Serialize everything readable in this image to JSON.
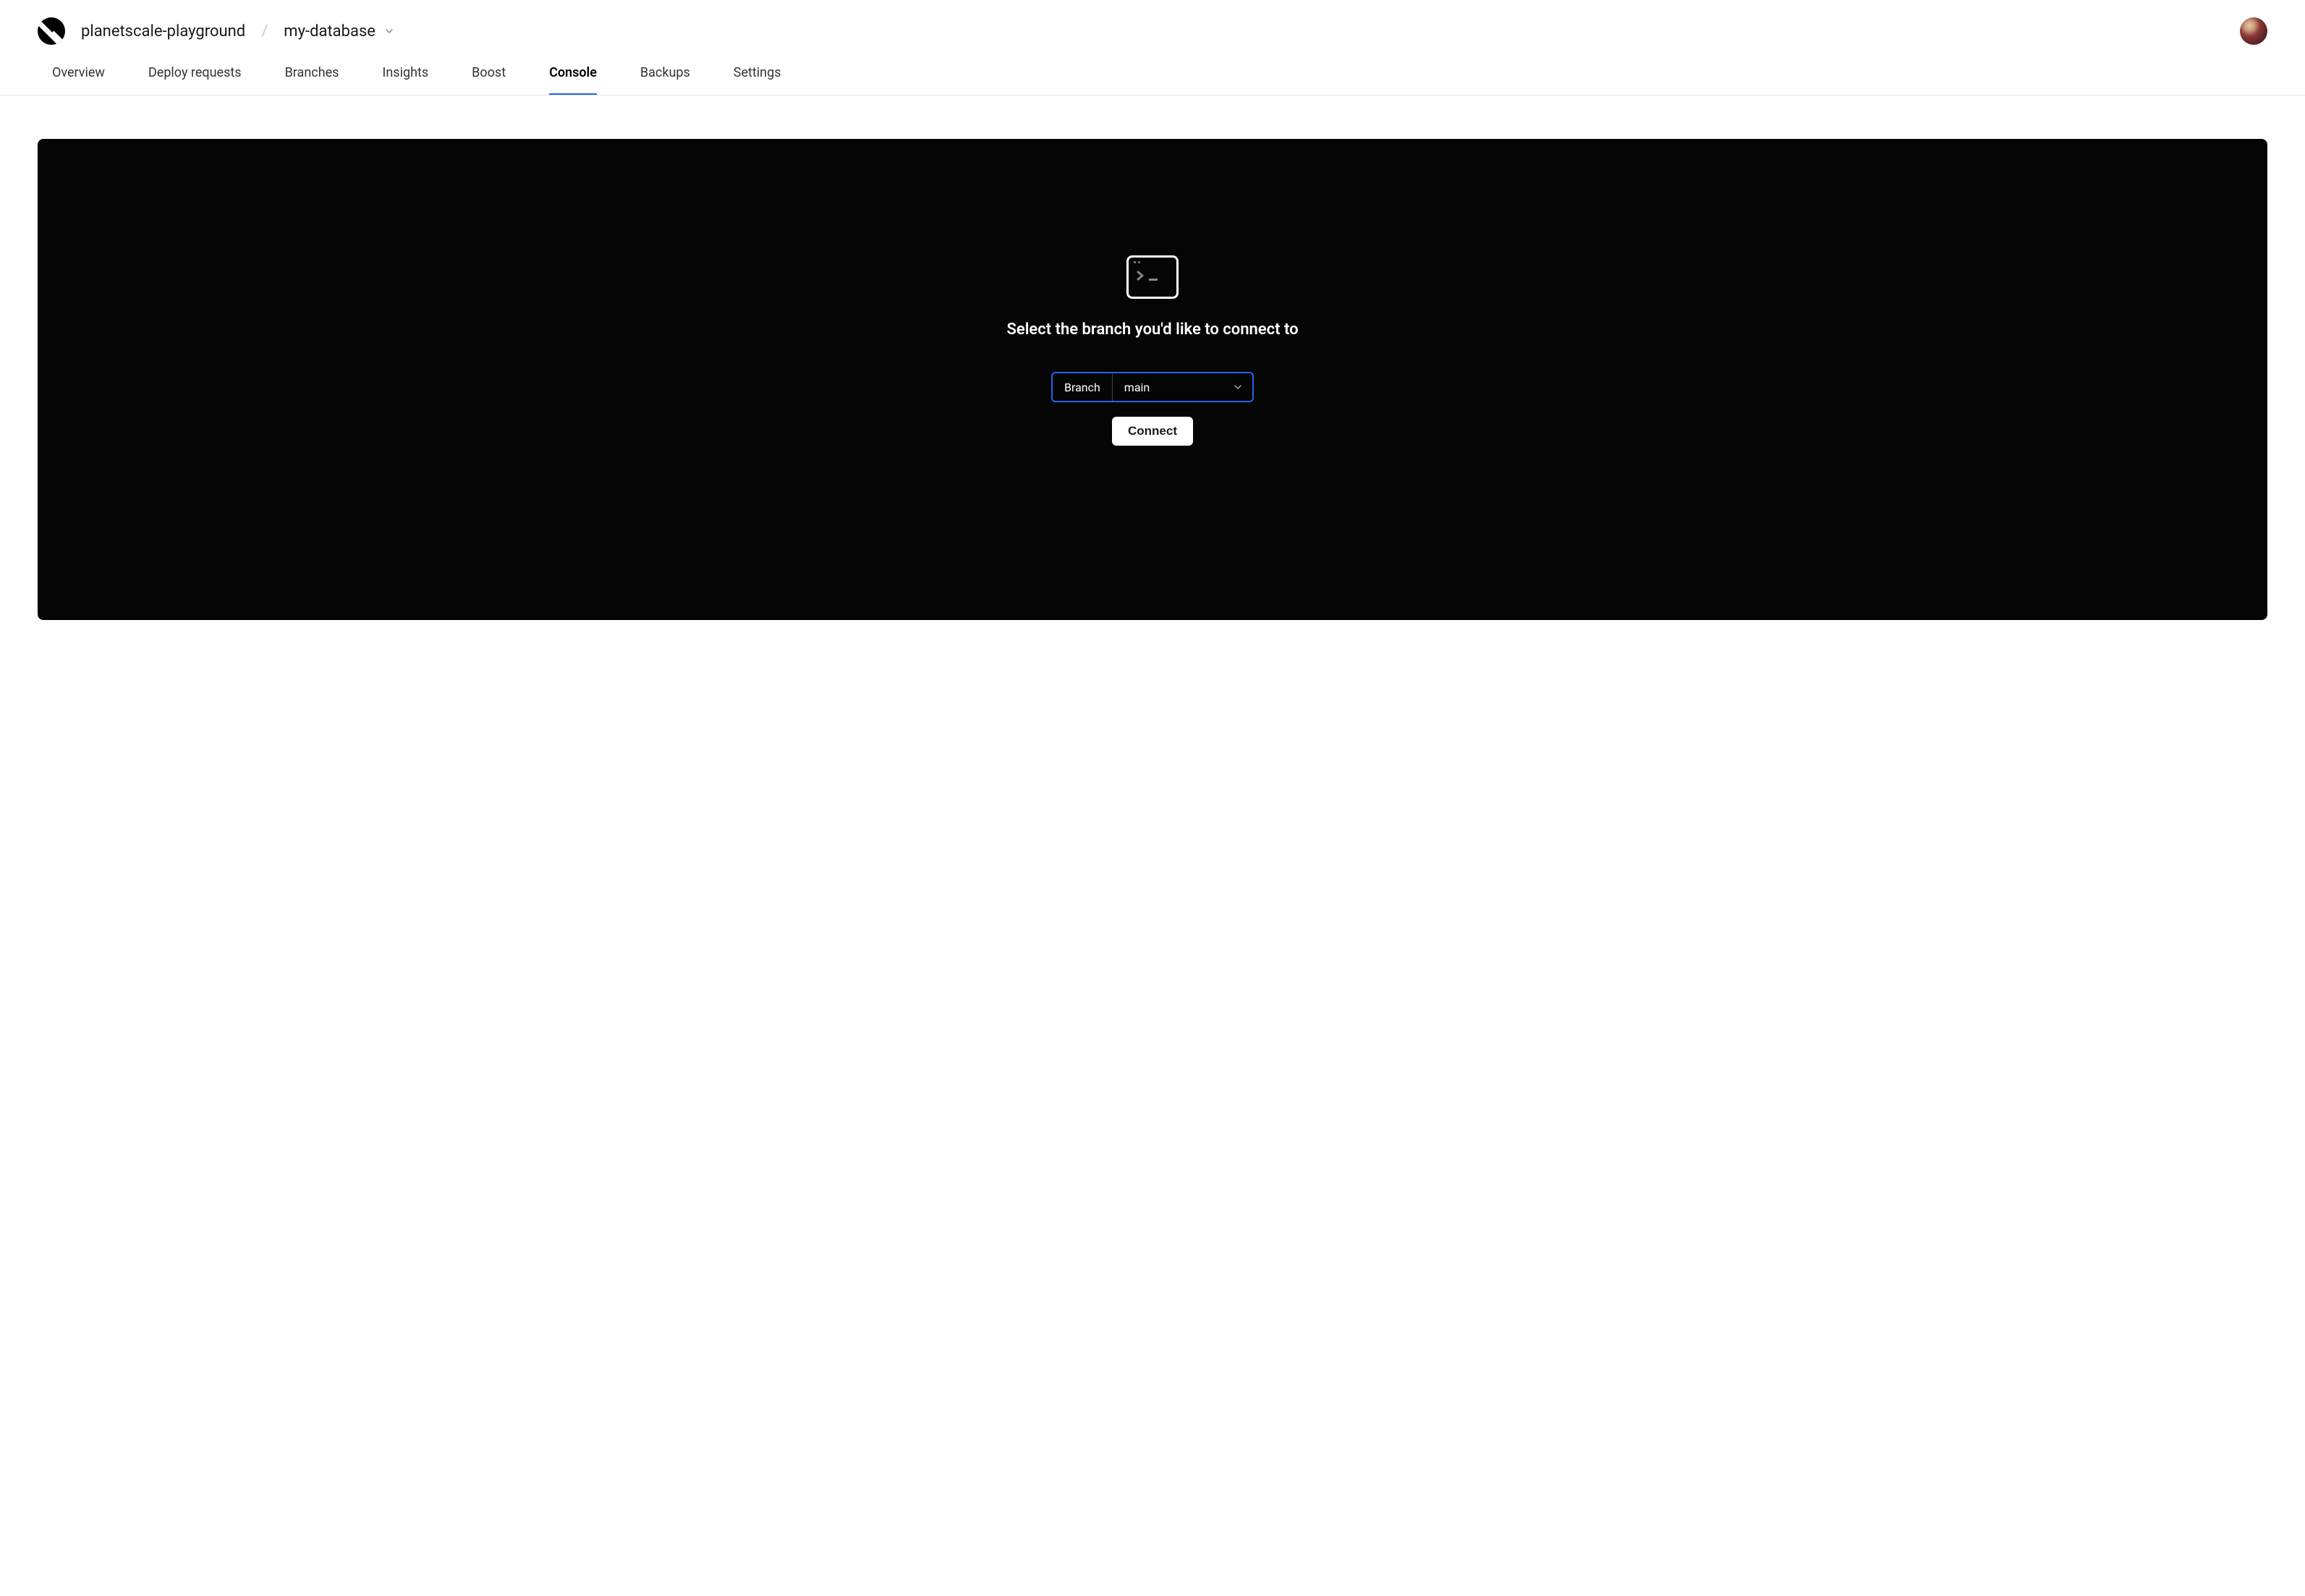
{
  "breadcrumb": {
    "org": "planetscale-playground",
    "separator": "/",
    "database": "my-database"
  },
  "tabs": [
    {
      "label": "Overview",
      "active": false
    },
    {
      "label": "Deploy requests",
      "active": false
    },
    {
      "label": "Branches",
      "active": false
    },
    {
      "label": "Insights",
      "active": false
    },
    {
      "label": "Boost",
      "active": false
    },
    {
      "label": "Console",
      "active": true
    },
    {
      "label": "Backups",
      "active": false
    },
    {
      "label": "Settings",
      "active": false
    }
  ],
  "console": {
    "heading": "Select the branch you'd like to connect to",
    "branch_label": "Branch",
    "branch_value": "main",
    "connect_label": "Connect"
  }
}
